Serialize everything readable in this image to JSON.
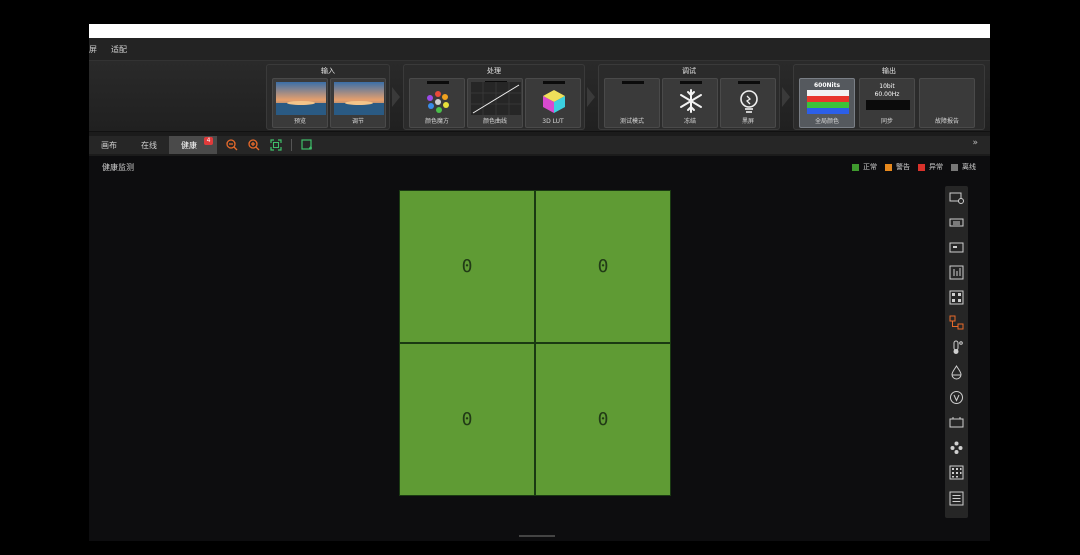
{
  "menu": [
    "屏",
    "适配"
  ],
  "pipeline": {
    "groups": [
      {
        "title": "输入",
        "cards": [
          {
            "label": "预览",
            "thumb": "landscape"
          },
          {
            "label": "调节",
            "thumb": "landscape"
          }
        ]
      },
      {
        "title": "处理",
        "cards": [
          {
            "label": "颜色魔方",
            "icon": "color-wheel-icon"
          },
          {
            "label": "颜色曲线",
            "icon": "curve-icon"
          },
          {
            "label": "3D LUT",
            "icon": "cube-icon"
          }
        ]
      },
      {
        "title": "调试",
        "cards": [
          {
            "label": "测试模式",
            "icon": "blank-icon"
          },
          {
            "label": "冻结",
            "icon": "snowflake-icon"
          },
          {
            "label": "黑屏",
            "icon": "bulb-icon"
          }
        ]
      },
      {
        "title": "输出",
        "cards": [
          {
            "label": "全局颜色",
            "icon": "color-bars-icon",
            "top": "600Nits",
            "active": true
          },
          {
            "label": "同步",
            "icon": "sync-text",
            "top": "10bit",
            "sub": "60.00Hz"
          },
          {
            "label": "故障报告",
            "icon": "blank-icon"
          }
        ]
      }
    ]
  },
  "tabs": [
    {
      "label": "画布"
    },
    {
      "label": "在线"
    },
    {
      "label": "健康",
      "badge": "4",
      "active": true
    }
  ],
  "main": {
    "section_title": "健康监测",
    "legend": [
      {
        "label": "正常",
        "color": "#3f9a2e"
      },
      {
        "label": "警告",
        "color": "#e8891d"
      },
      {
        "label": "异常",
        "color": "#d9322b"
      },
      {
        "label": "离线",
        "color": "#777777"
      }
    ],
    "cells": [
      {
        "value": "0"
      },
      {
        "value": "0"
      },
      {
        "value": "0"
      },
      {
        "value": "0"
      }
    ],
    "cell_color": "#5f9b34"
  },
  "more": "»"
}
